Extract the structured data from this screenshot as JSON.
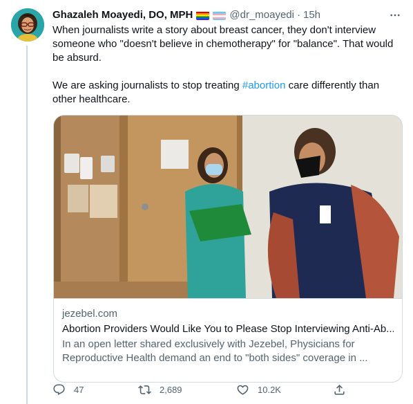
{
  "tweet": {
    "author_name": "Ghazaleh Moayedi, DO, MPH",
    "handle": "@dr_moayedi",
    "separator": "·",
    "time": "15h",
    "flags": [
      "rainbow-pride-flag-icon",
      "transgender-flag-icon"
    ],
    "text_p1": "When journalists write a story about breast cancer, they don't interview someone who \"doesn't believe in chemotherapy\" for \"balance\". That would be absurd.",
    "text_p2_before": "We are asking journalists to stop treating ",
    "hashtag": "#abortion",
    "text_p2_after": " care differently than other healthcare."
  },
  "card": {
    "domain": "jezebel.com",
    "title": "Abortion Providers Would Like You to Please Stop Interviewing Anti-Ab...",
    "description": "In an open letter shared exclusively with Jezebel, Physicians for Reproductive Health demand an end to \"both sides\" coverage in ..."
  },
  "actions": {
    "replies": "47",
    "retweets": "2,689",
    "likes": "10.2K"
  },
  "colors": {
    "accent": "#1d9bf0",
    "secondary_text": "#536471",
    "border": "#cfd9de"
  },
  "icons": {
    "reply": "reply-icon",
    "retweet": "retweet-icon",
    "like": "heart-icon",
    "share": "share-icon",
    "more": "more-icon"
  }
}
